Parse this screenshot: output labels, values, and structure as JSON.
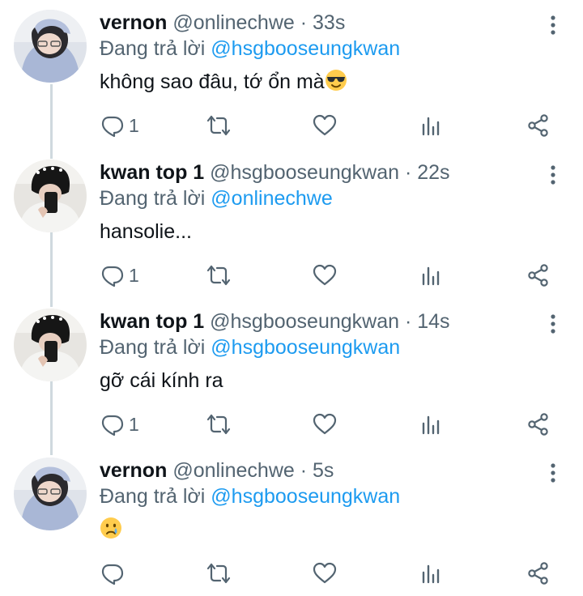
{
  "tweets": [
    {
      "name": "vernon",
      "handle": "@onlinechwe",
      "dot": "·",
      "time": "33s",
      "reply_prefix": "Đang trả lời",
      "reply_to": "@hsgbooseungkwan",
      "text": "không sao đâu, tớ ổn mà",
      "emoji": "smiling-face-with-sunglasses",
      "reply_count": "1"
    },
    {
      "name": "kwan top 1",
      "handle": "@hsgbooseungkwan",
      "dot": "·",
      "time": "22s",
      "reply_prefix": "Đang trả lời",
      "reply_to": "@onlinechwe",
      "text": "hansolie...",
      "reply_count": "1"
    },
    {
      "name": "kwan top 1",
      "handle": "@hsgbooseungkwan",
      "dot": "·",
      "time": "14s",
      "reply_prefix": "Đang trả lời",
      "reply_to": "@hsgbooseungkwan",
      "text": "gỡ cái kính ra",
      "reply_count": "1"
    },
    {
      "name": "vernon",
      "handle": "@onlinechwe",
      "dot": "·",
      "time": "5s",
      "reply_prefix": "Đang trả lời",
      "reply_to": "@hsgbooseungkwan",
      "text": "",
      "emoji": "crying-face",
      "reply_count": ""
    }
  ],
  "icons": {
    "reply": "reply-icon",
    "retweet": "retweet-icon",
    "like": "heart-icon",
    "analytics": "analytics-icon",
    "share": "share-icon",
    "more": "more-vertical-icon"
  },
  "colors": {
    "text": "#0f1419",
    "secondary": "#536471",
    "mention": "#1d9bf0",
    "thread_line": "#cfd9de"
  }
}
